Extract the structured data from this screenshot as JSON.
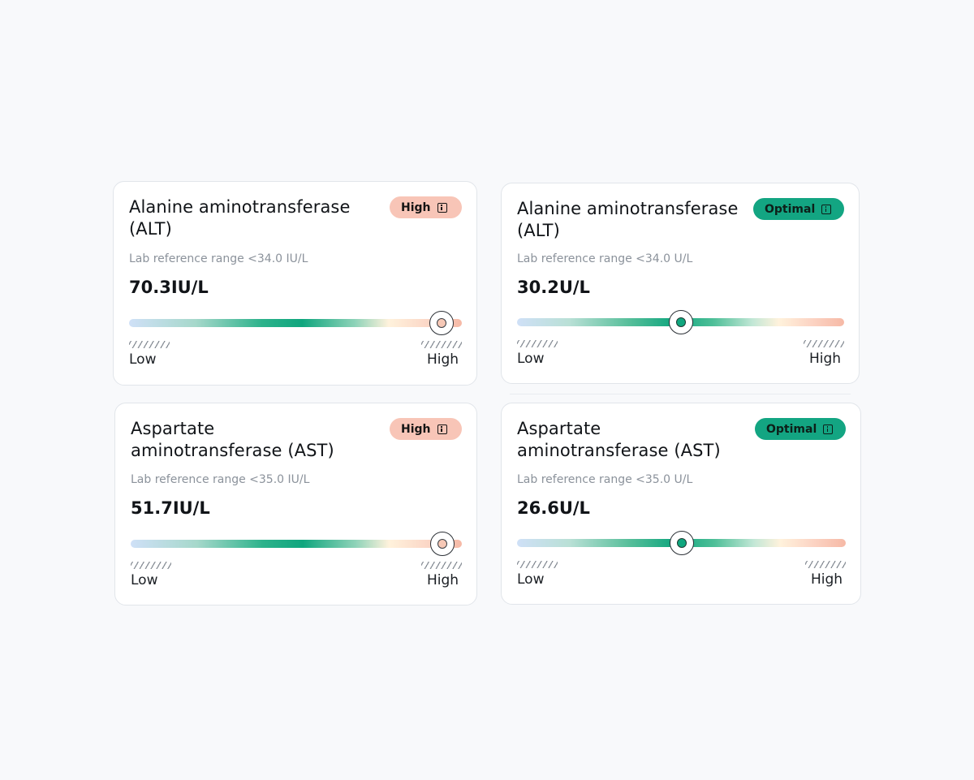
{
  "cards": [
    {
      "title": "Alanine aminotransferase (ALT)",
      "status": "High",
      "status_color": "#f8c5b7",
      "status_icon": "info-icon",
      "reference": "Lab reference range <34.0 IU/L",
      "value": "70.3IU/L",
      "scale_position": 0.94,
      "scale_low": "Low",
      "scale_high": "High"
    },
    {
      "title": "Alanine aminotransferase (ALT)",
      "status": "Optimal",
      "status_color": "#13a582",
      "status_icon": "info-icon",
      "reference": "Lab reference range <34.0 U/L",
      "value": "30.2U/L",
      "scale_position": 0.5,
      "scale_low": "Low",
      "scale_high": "High"
    },
    {
      "title": "Aspartate aminotransferase (AST)",
      "status": "High",
      "status_color": "#f8c5b7",
      "status_icon": "info-icon",
      "reference": "Lab reference range <35.0 IU/L",
      "value": "51.7IU/L",
      "scale_position": 0.94,
      "scale_low": "Low",
      "scale_high": "High"
    },
    {
      "title": "Aspartate aminotransferase (AST)",
      "status": "Optimal",
      "status_color": "#13a582",
      "status_icon": "info-icon",
      "reference": "Lab reference range <35.0 U/L",
      "value": "26.6U/L",
      "scale_position": 0.5,
      "scale_low": "Low",
      "scale_high": "High"
    }
  ]
}
